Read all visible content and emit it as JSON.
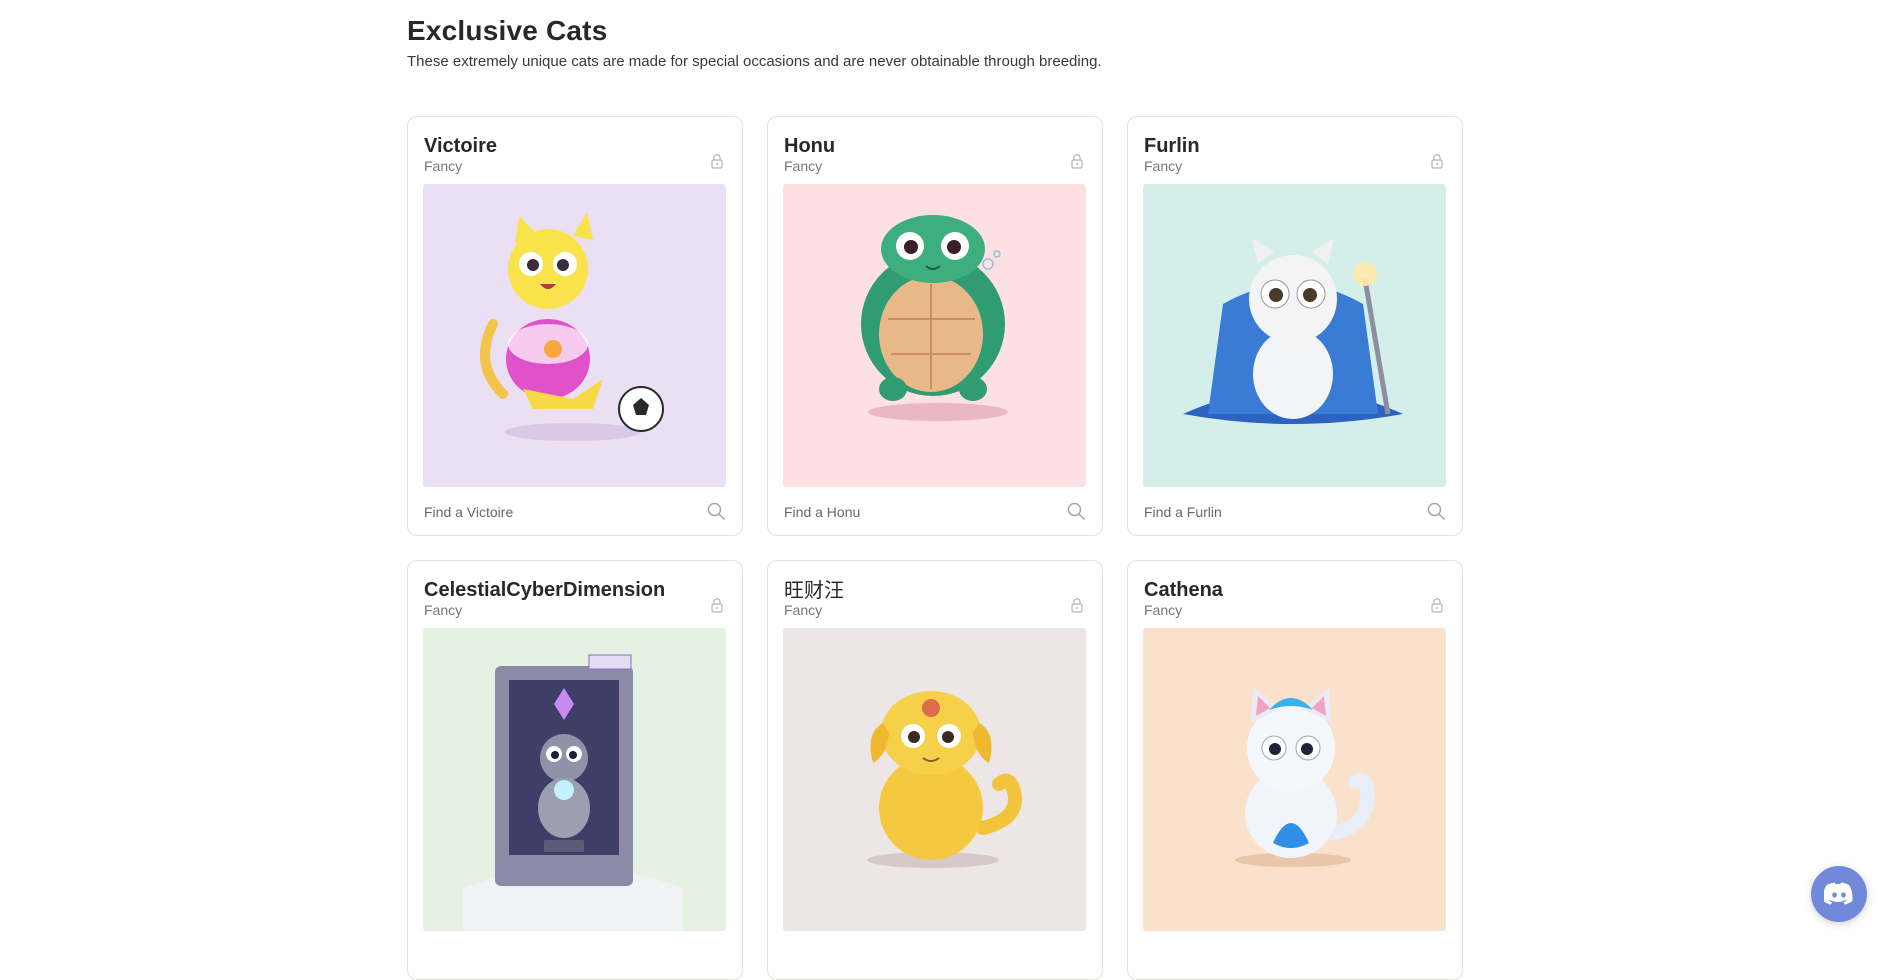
{
  "page": {
    "title": "Exclusive Cats",
    "subtitle": "These extremely unique cats are made for special occasions and are never obtainable through breeding."
  },
  "colors": {
    "discord": "#7289da",
    "card_border": "#e3e1dd",
    "text_muted": "#7b7770"
  },
  "cards": [
    {
      "name": "Victoire",
      "kind": "Fancy",
      "find": "Find a Victoire",
      "bg": "#eadff3",
      "art": "soccer-cat"
    },
    {
      "name": "Honu",
      "kind": "Fancy",
      "find": "Find a Honu",
      "bg": "#fde0e4",
      "art": "turtle-cat"
    },
    {
      "name": "Furlin",
      "kind": "Fancy",
      "find": "Find a Furlin",
      "bg": "#d4efea",
      "art": "wizard-cat"
    },
    {
      "name": "CelestialCyberDimension",
      "kind": "Fancy",
      "find": "",
      "bg": "#e4f1e3",
      "art": "cyber-portal-cat"
    },
    {
      "name": "旺财汪",
      "kind": "Fancy",
      "find": "",
      "bg": "#ede6e6",
      "art": "golden-dog-cat"
    },
    {
      "name": "Cathena",
      "kind": "Fancy",
      "find": "",
      "bg": "#fae1cc",
      "art": "ice-cat"
    }
  ],
  "icons": {
    "lock": "lock-icon",
    "search": "search-icon",
    "discord": "discord-icon"
  }
}
